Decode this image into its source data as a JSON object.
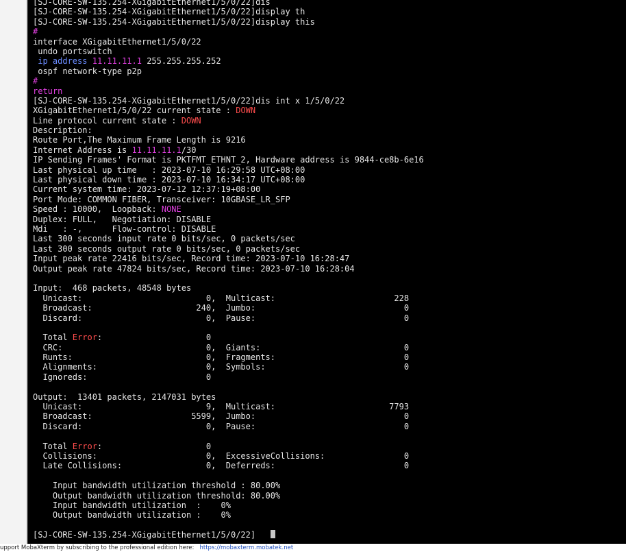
{
  "terminal": {
    "prompt": "[SJ-CORE-SW-135.254-XGigabitEthernet1/5/0/22]",
    "colors": {
      "text": "#e6e6e6",
      "keyword_pink": "#e040e0",
      "keyword_blue": "#6b8cff",
      "alert_red": "#ff4d4d",
      "background": "#000000"
    },
    "lines": [
      [
        {
          "t": "[SJ-CORE-SW-135.254-XGigabitEthernet1/5/0/22]dis"
        }
      ],
      [
        {
          "t": "[SJ-CORE-SW-135.254-XGigabitEthernet1/5/0/22]display th"
        }
      ],
      [
        {
          "t": "[SJ-CORE-SW-135.254-XGigabitEthernet1/5/0/22]display this"
        }
      ],
      [
        {
          "t": "#",
          "c": "pink"
        }
      ],
      [
        {
          "t": "interface XGigabitEthernet1/5/0/22"
        }
      ],
      [
        {
          "t": " undo portswitch"
        }
      ],
      [
        {
          "t": " ip address",
          "c": "blue"
        },
        {
          "t": " "
        },
        {
          "t": "11.11.11.1",
          "c": "pink"
        },
        {
          "t": " 255.255.255.252"
        }
      ],
      [
        {
          "t": " ospf network-type p2p"
        }
      ],
      [
        {
          "t": "#",
          "c": "pink"
        }
      ],
      [
        {
          "t": "return",
          "c": "pink"
        }
      ],
      [
        {
          "t": "[SJ-CORE-SW-135.254-XGigabitEthernet1/5/0/22]dis int x 1/5/0/22"
        }
      ],
      [
        {
          "t": "XGigabitEthernet1/5/0/22 current state : "
        },
        {
          "t": "DOWN",
          "c": "red"
        }
      ],
      [
        {
          "t": "Line protocol current state : "
        },
        {
          "t": "DOWN",
          "c": "red"
        }
      ],
      [
        {
          "t": "Description:"
        }
      ],
      [
        {
          "t": "Route Port,The Maximum Frame Length is 9216"
        }
      ],
      [
        {
          "t": "Internet Address is "
        },
        {
          "t": "11.11.11.1",
          "c": "pink"
        },
        {
          "t": "/30"
        }
      ],
      [
        {
          "t": "IP Sending Frames' Format is PKTFMT_ETHNT_2, Hardware address is 9844-ce8b-6e16"
        }
      ],
      [
        {
          "t": "Last physical up time   : 2023-07-10 16:29:58 UTC+08:00"
        }
      ],
      [
        {
          "t": "Last physical down time : 2023-07-10 16:34:17 UTC+08:00"
        }
      ],
      [
        {
          "t": "Current system time: 2023-07-12 12:37:19+08:00"
        }
      ],
      [
        {
          "t": "Port Mode: COMMON FIBER, Transceiver: 10GBASE_LR_SFP"
        }
      ],
      [
        {
          "t": "Speed : 10000,  Loopback: "
        },
        {
          "t": "NONE",
          "c": "pink"
        }
      ],
      [
        {
          "t": "Duplex: FULL,   Negotiation: DISABLE"
        }
      ],
      [
        {
          "t": "Mdi   : -,      Flow-control: DISABLE"
        }
      ],
      [
        {
          "t": "Last 300 seconds input rate 0 bits/sec, 0 packets/sec"
        }
      ],
      [
        {
          "t": "Last 300 seconds output rate 0 bits/sec, 0 packets/sec"
        }
      ],
      [
        {
          "t": "Input peak rate 22416 bits/sec, Record time: 2023-07-10 16:28:47"
        }
      ],
      [
        {
          "t": "Output peak rate 47824 bits/sec, Record time: 2023-07-10 16:28:04"
        }
      ],
      [
        {
          "t": ""
        }
      ],
      [
        {
          "t": "Input:  468 packets, 48548 bytes"
        }
      ],
      [
        {
          "t": "  Unicast:                         0,  Multicast:                        228"
        }
      ],
      [
        {
          "t": "  Broadcast:                     240,  Jumbo:                              0"
        }
      ],
      [
        {
          "t": "  Discard:                         0,  Pause:                              0"
        }
      ],
      [
        {
          "t": ""
        }
      ],
      [
        {
          "t": "  Total "
        },
        {
          "t": "Error",
          "c": "red"
        },
        {
          "t": ":                     0"
        }
      ],
      [
        {
          "t": "  CRC:                             0,  Giants:                             0"
        }
      ],
      [
        {
          "t": "  Runts:                           0,  Fragments:                          0"
        }
      ],
      [
        {
          "t": "  Alignments:                      0,  Symbols:                            0"
        }
      ],
      [
        {
          "t": "  Ignoreds:                        0"
        }
      ],
      [
        {
          "t": ""
        }
      ],
      [
        {
          "t": "Output:  13401 packets, 2147031 bytes"
        }
      ],
      [
        {
          "t": "  Unicast:                         9,  Multicast:                       7793"
        }
      ],
      [
        {
          "t": "  Broadcast:                    5599,  Jumbo:                              0"
        }
      ],
      [
        {
          "t": "  Discard:                         0,  Pause:                              0"
        }
      ],
      [
        {
          "t": ""
        }
      ],
      [
        {
          "t": "  Total "
        },
        {
          "t": "Error",
          "c": "red"
        },
        {
          "t": ":                     0"
        }
      ],
      [
        {
          "t": "  Collisions:                      0,  ExcessiveCollisions:                0"
        }
      ],
      [
        {
          "t": "  Late Collisions:                 0,  Deferreds:                          0"
        }
      ],
      [
        {
          "t": ""
        }
      ],
      [
        {
          "t": "    Input bandwidth utilization threshold : 80.00%"
        }
      ],
      [
        {
          "t": "    Output bandwidth utilization threshold: 80.00%"
        }
      ],
      [
        {
          "t": "    Input bandwidth utilization  :    0%"
        }
      ],
      [
        {
          "t": "    Output bandwidth utilization :    0%"
        }
      ],
      [
        {
          "t": ""
        }
      ]
    ]
  },
  "status_bar": {
    "message": "upport MobaXterm by subscribing to the professional edition here:",
    "link_text": "https://mobaxterm.mobatek.net"
  }
}
